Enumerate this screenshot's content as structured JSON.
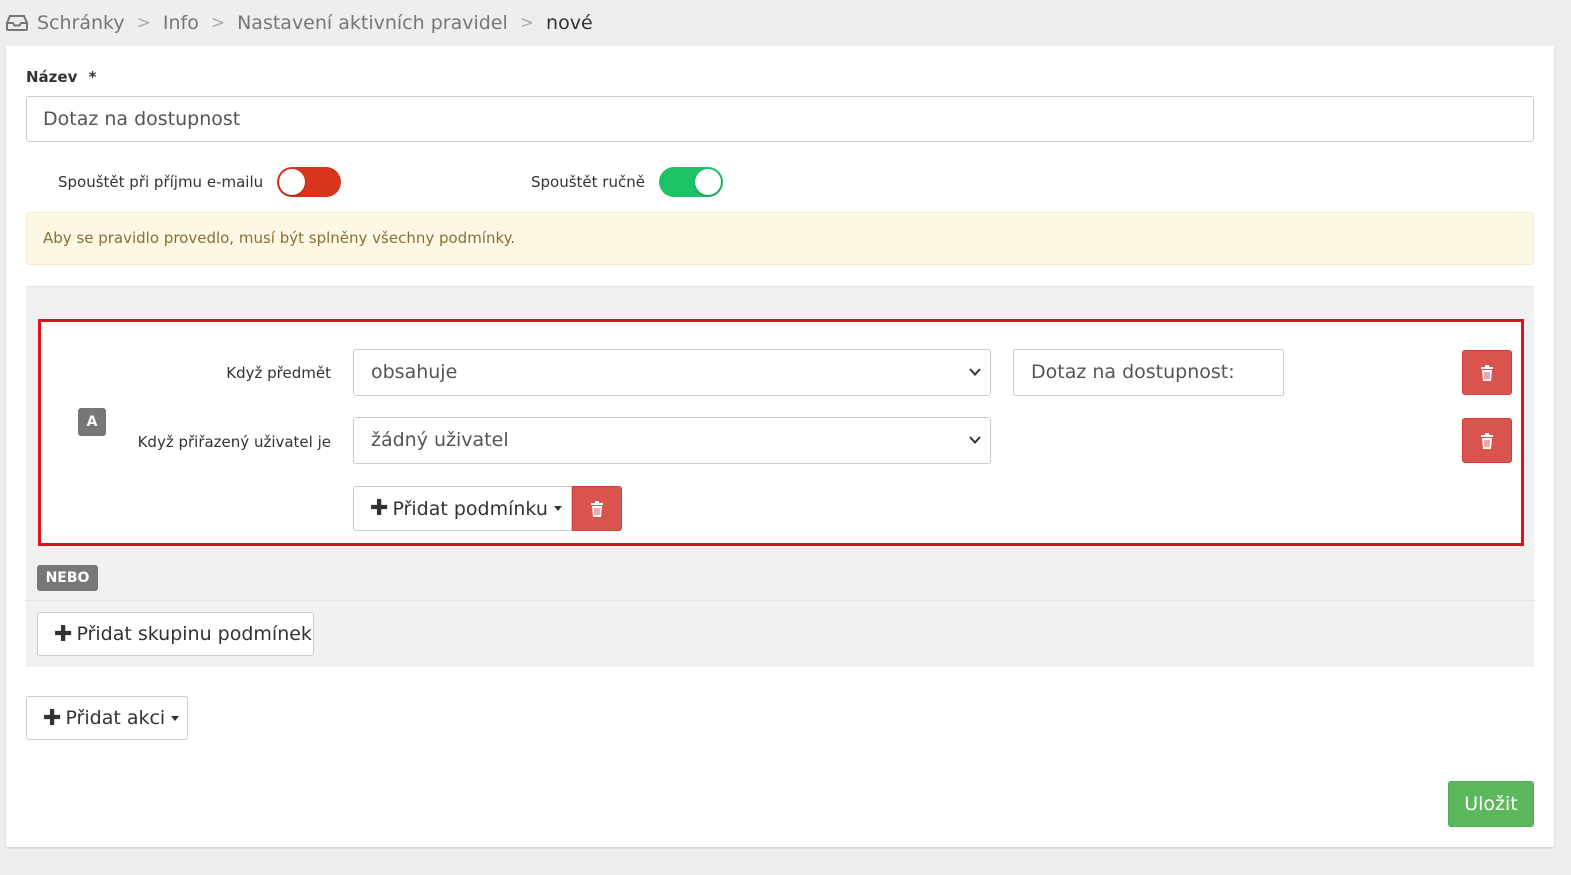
{
  "breadcrumb": {
    "icon": "inbox-icon",
    "items": [
      "Schránky",
      "Info",
      "Nastavení aktivních pravidel",
      "nové"
    ],
    "separator": ">"
  },
  "form": {
    "name_label": "Název",
    "required_mark": "*",
    "name_value": "Dotaz na dostupnost",
    "toggles": [
      {
        "label": "Spouštět při příjmu e-mailu",
        "state": "off",
        "color": "#d9351c"
      },
      {
        "label": "Spouštět ručně",
        "state": "on",
        "color": "#1ec266"
      }
    ],
    "alert_text": "Aby se pravidlo provedlo, musí být splněny všechny podmínky."
  },
  "conditions": {
    "group_badge": "A",
    "rows": [
      {
        "label": "Když předmět",
        "operator": "obsahuje",
        "value": "Dotaz na dostupnost:"
      },
      {
        "label": "Když přiřazený uživatel je",
        "operator": "žádný uživatel",
        "value": null
      }
    ],
    "add_condition_label": "Přidat podmínku",
    "or_badge": "NEBO",
    "add_group_label": "Přidat skupinu podmínek"
  },
  "actions": {
    "add_action_label": "Přidat akci"
  },
  "save_label": "Uložit",
  "colors": {
    "danger": "#d9534f",
    "success": "#5cb85c",
    "highlight_border": "#e0101e"
  }
}
